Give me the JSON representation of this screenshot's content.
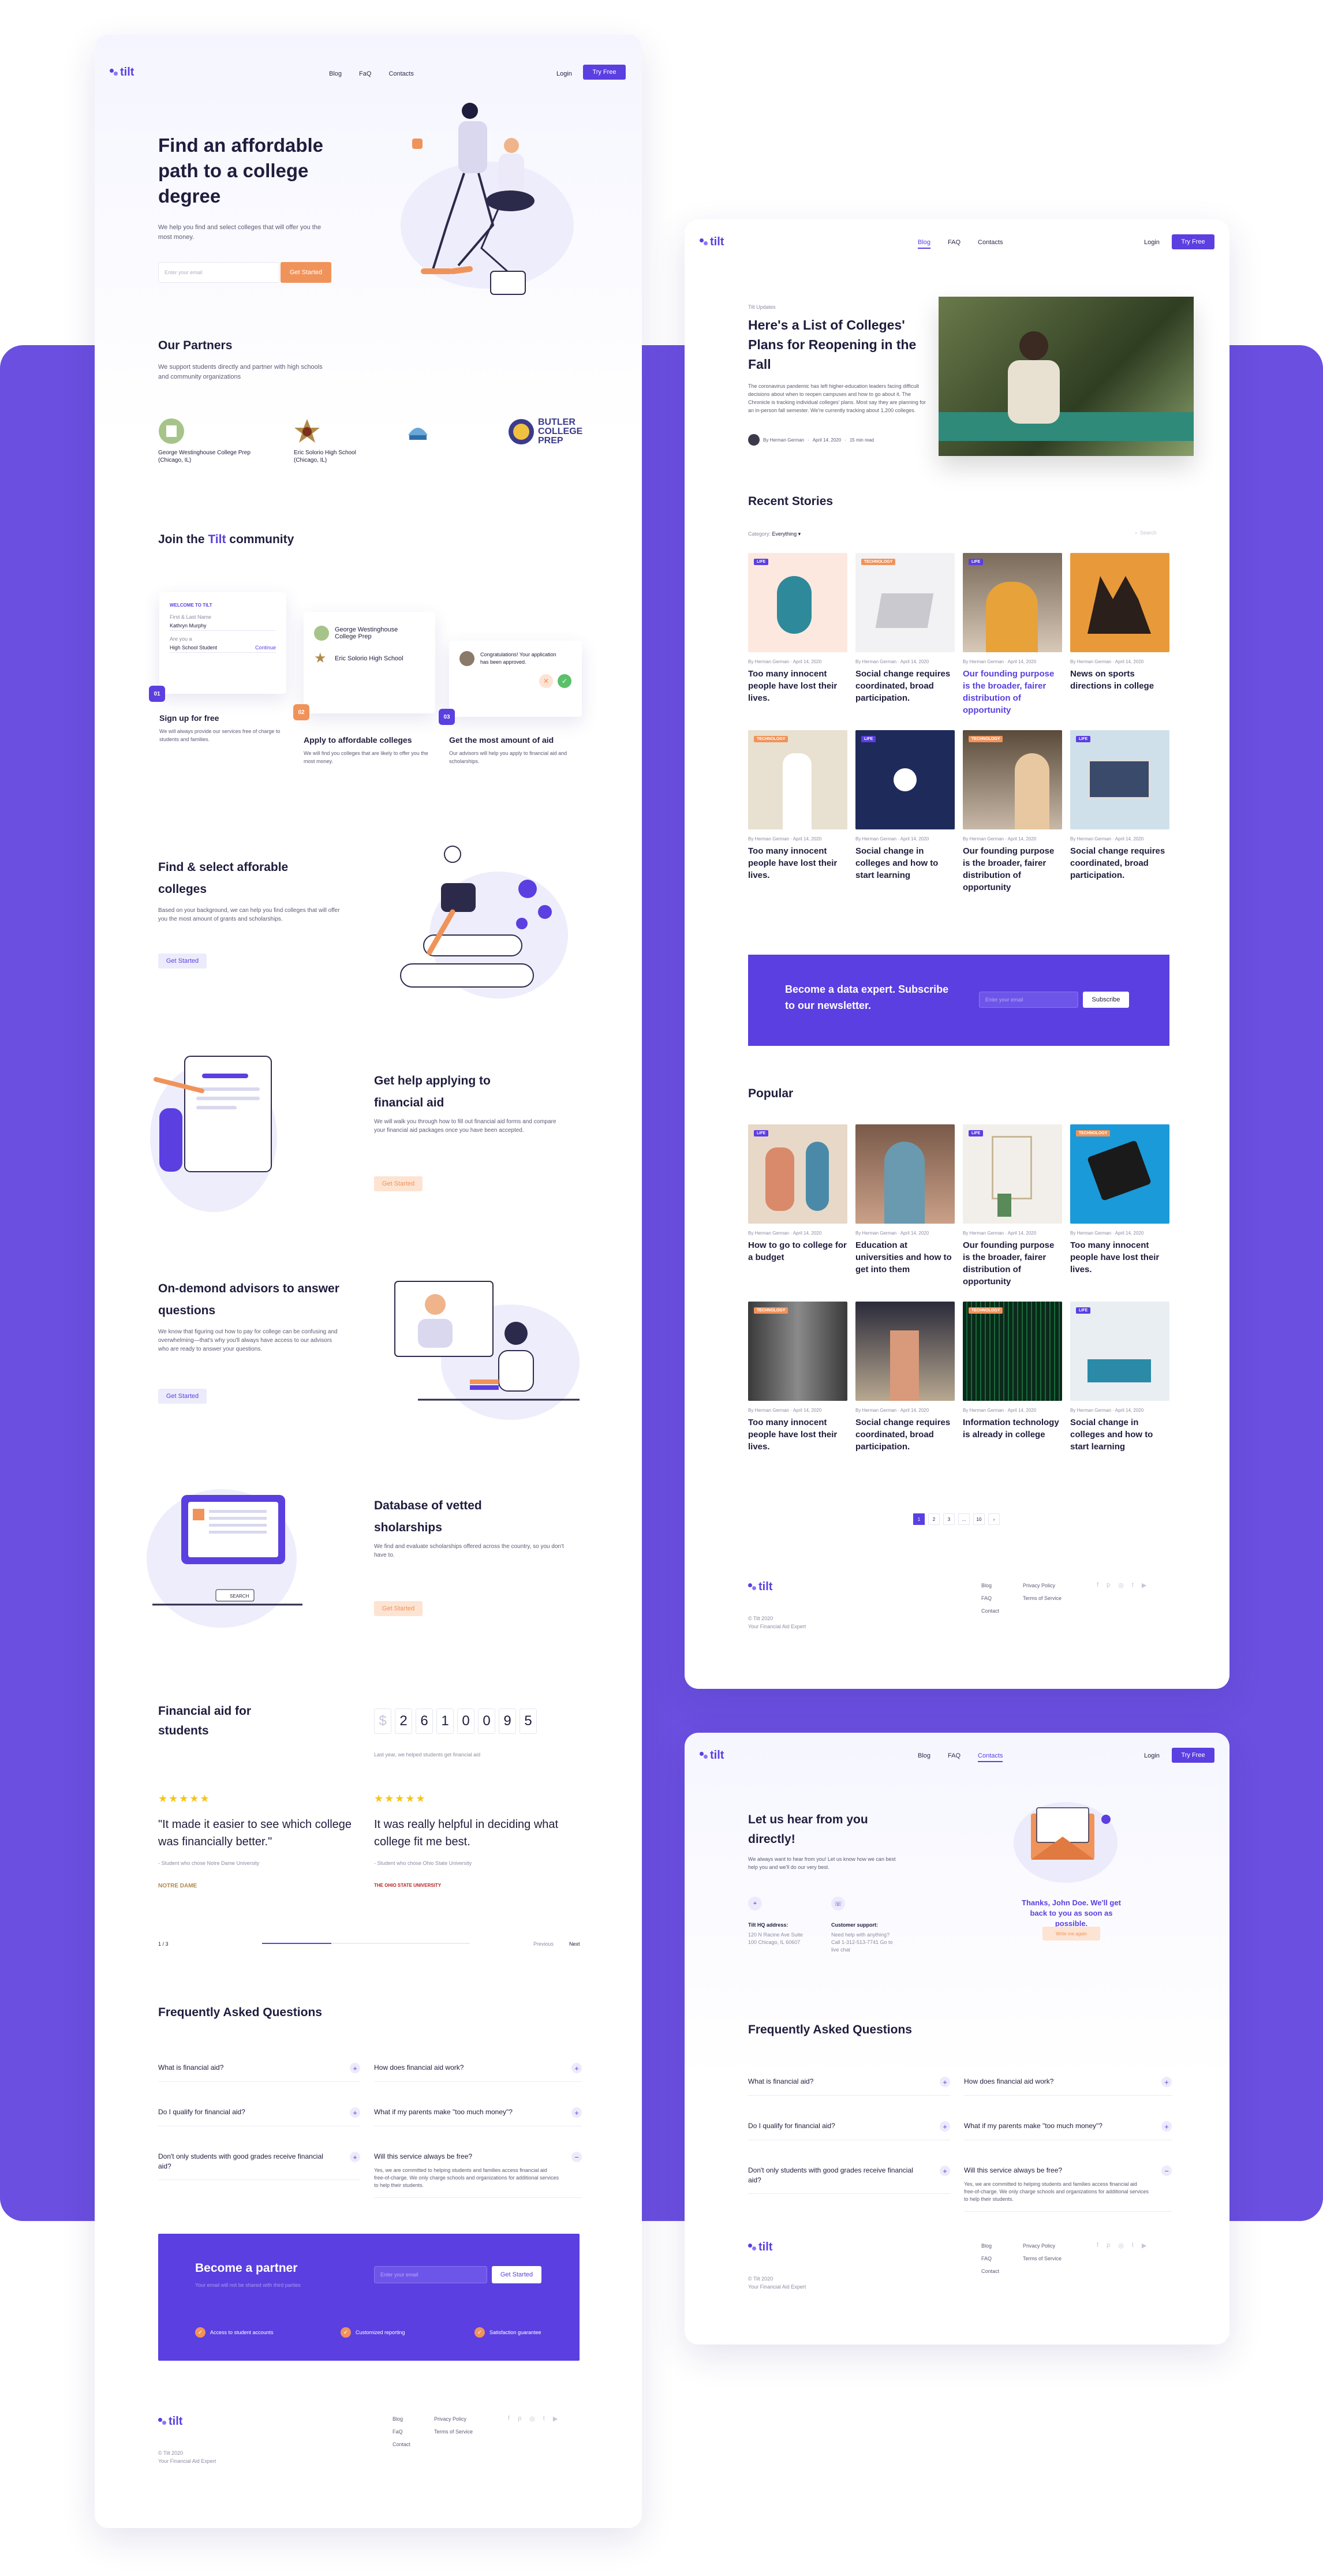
{
  "colors": {
    "brand": "#5b3fe0",
    "accent_orange": "#f0935a",
    "band": "#6b4fe0",
    "star": "#f5c518"
  },
  "brand": {
    "name": "tilt"
  },
  "home": {
    "nav": {
      "blog": "Blog",
      "faq": "FaQ",
      "contacts": "Contacts",
      "login": "Login",
      "try": "Try Free"
    },
    "hero": {
      "title": "Find an affordable path to a college degree",
      "subtitle": "We help you find and select colleges that will offer you the most money.",
      "email_placeholder": "Enter your email",
      "cta": "Get Started"
    },
    "partners": {
      "title": "Our Partners",
      "subtitle": "We support students directly and partner with high schools and community organizations",
      "items": [
        {
          "name": "George Westinghouse College Prep (Chicago, IL)"
        },
        {
          "name": "Eric Solorio High School (Chicago, IL)"
        },
        {
          "name": ""
        },
        {
          "name": "BUTLER COLLEGE PREP"
        }
      ]
    },
    "community": {
      "title_prefix": "Join the ",
      "title_brand": "Tilt",
      "title_suffix": " community",
      "card1": {
        "header": "WELCOME TO TILT",
        "l1": "First & Last Name",
        "l2": "Kathryn Murphy",
        "l3": "Are you a",
        "l4": "High School Student",
        "continue": "Continue"
      },
      "card2": {
        "s1": "George Westinghouse College Prep",
        "s2": "Eric Solorio High School"
      },
      "card3": {
        "msg": "Congratulations! Your application has been approved."
      },
      "steps": [
        {
          "num": "01",
          "title": "Sign up for free",
          "text": "We will always provide our services free of charge to students and families."
        },
        {
          "num": "02",
          "title": "Apply to affordable colleges",
          "text": "We will find you colleges that are likely to offer you the most money."
        },
        {
          "num": "03",
          "title": "Get the most amount of aid",
          "text": "Our advisors will help you apply to financial aid and scholarships."
        }
      ]
    },
    "feature1": {
      "title": "Find & select afforable colleges",
      "text": "Based on your background, we can help you find colleges that will offer you the most amount of grants and scholarships.",
      "cta": "Get Started"
    },
    "feature2": {
      "title": "Get help applying to financial aid",
      "text": "We will walk you through how to fill out financial aid forms and compare your financial aid packages once you have been accepted.",
      "cta": "Get Started"
    },
    "feature3": {
      "title": "On-demond advisors to answer questions",
      "text": "We know that figuring out how to pay for college can be confusing and overwhelming—that's why you'll always have access to our advisors who are ready to answer your questions.",
      "cta": "Get Started"
    },
    "feature4": {
      "title": "Database of vetted sholarships",
      "text": "We find and evaluate scholarships offered across the country, so you don't have to.",
      "cta": "Get Started",
      "search": "SEARCH"
    },
    "stats": {
      "title": "Financial aid for students",
      "digits": [
        "$",
        "2",
        "6",
        "1",
        "0",
        "0",
        "9",
        "5"
      ],
      "caption": "Last year, we helped students get financial aid"
    },
    "testimonials": [
      {
        "stars": "★★★★★",
        "quote": "\"It made it easier to see which college was financially better.\"",
        "author": "- Student who chose Notre Dame University",
        "logo": "NOTRE DAME"
      },
      {
        "stars": "★★★★★",
        "quote": "It was really helpful in deciding what college fit me best.",
        "author": "- Student who chose Ohio State University",
        "logo": "THE OHIO STATE UNIVERSITY"
      }
    ],
    "slider": {
      "counter": "1 / 3",
      "prev": "Previous",
      "next": "Next"
    },
    "faq": {
      "title": "Frequently Asked Questions",
      "left": [
        "What is financial aid?",
        "Do I qualify for financial aid?",
        "Don't only students with good grades receive financial aid?"
      ],
      "right": [
        "How does financial aid work?",
        "What if my parents make \"too much money\"?",
        "Will this service always be free?"
      ],
      "answer": "Yes, we are committed to helping students and families access financial aid free-of-charge. We only charge schools and organizations for additional services to help their students."
    },
    "partner_cta": {
      "title": "Become a partner",
      "subtitle": "Your email will not be shared with third parties",
      "placeholder": "Enter your email",
      "cta": "Get Started",
      "benefits": [
        "Access to student accounts",
        "Customized reporting",
        "Satisfaction guarantee"
      ]
    },
    "footer": {
      "copy": "© Tilt 2020",
      "tag": "Your Financial Aid Expert",
      "links1": [
        "Blog",
        "FaQ",
        "Contact"
      ],
      "links2": [
        "Privacy Policy",
        "Terms of Service"
      ]
    }
  },
  "blog": {
    "nav": {
      "blog": "Blog",
      "faq": "FAQ",
      "contacts": "Contacts",
      "login": "Login",
      "try": "Try Free"
    },
    "featured": {
      "tag": "Tilt Updates",
      "title": "Here's a List of Colleges' Plans for Reopening in the Fall",
      "text": "The coronavirus pandemic has left higher-education leaders facing difficult decisions about when to reopen campuses and how to go about it. The Chronicle is tracking individual colleges' plans. Most say they are planning for an in-person fall semester. We're currently tracking about 1,200 colleges.",
      "author": "By Herman German",
      "date": "April 14, 2020",
      "read": "15 min read"
    },
    "recent_title": "Recent Stories",
    "category_label": "Category:",
    "category_value": "Everything",
    "search_placeholder": "Search",
    "recent": [
      {
        "badge": "LIFE",
        "meta": "By Herman German · April 14, 2020",
        "title": "Too many innocent people have lost their lives."
      },
      {
        "badge": "TECHNOLOGY",
        "meta": "By Herman German · April 14, 2020",
        "title": "Social change requires coordinated, broad participation."
      },
      {
        "badge": "LIFE",
        "meta": "By Herman German · April 14, 2020",
        "title": "Our founding purpose is the broader, fairer distribution of opportunity"
      },
      {
        "badge": "",
        "meta": "By Herman German · April 14, 2020",
        "title": "News on sports directions in college"
      },
      {
        "badge": "TECHNOLOGY",
        "meta": "By Herman German · April 14, 2020",
        "title": "Too many innocent people have lost their lives."
      },
      {
        "badge": "LIFE",
        "meta": "By Herman German · April 14, 2020",
        "title": "Social change in colleges and how to start learning"
      },
      {
        "badge": "TECHNOLOGY",
        "meta": "By Herman German · April 14, 2020",
        "title": "Our founding purpose is the broader, fairer distribution of opportunity"
      },
      {
        "badge": "LIFE",
        "meta": "By Herman German · April 14, 2020",
        "title": "Social change requires coordinated, broad participation."
      }
    ],
    "newsletter": {
      "title": "Become a data expert. Subscribe to our newsletter.",
      "placeholder": "Enter your email",
      "cta": "Subscribe"
    },
    "popular_title": "Popular",
    "popular": [
      {
        "badge": "LIFE",
        "meta": "By Herman German · April 14, 2020",
        "title": "How to go to college for a budget"
      },
      {
        "badge": "",
        "meta": "By Herman German · April 14, 2020",
        "title": "Education at universities and how to get into them"
      },
      {
        "badge": "LIFE",
        "meta": "By Herman German · April 14, 2020",
        "title": "Our founding purpose is the broader, fairer distribution of opportunity"
      },
      {
        "badge": "TECHNOLOGY",
        "meta": "By Herman German · April 14, 2020",
        "title": "Too many innocent people have lost their lives."
      },
      {
        "badge": "TECHNOLOGY",
        "meta": "By Herman German · April 14, 2020",
        "title": "Too many innocent people have lost their lives."
      },
      {
        "badge": "",
        "meta": "By Herman German · April 14, 2020",
        "title": "Social change requires coordinated, broad participation."
      },
      {
        "badge": "TECHNOLOGY",
        "meta": "By Herman German · April 14, 2020",
        "title": "Information technology is already in college"
      },
      {
        "badge": "LIFE",
        "meta": "By Herman German · April 14, 2020",
        "title": "Social change in colleges and how to start learning"
      }
    ],
    "pagination": [
      "1",
      "2",
      "3",
      "...",
      "10",
      "›"
    ],
    "footer": {
      "copy": "© Tilt 2020",
      "tag": "Your Financial Aid Expert",
      "links1": [
        "Blog",
        "FAQ",
        "Contact"
      ],
      "links2": [
        "Privacy Policy",
        "Terms of Service"
      ]
    }
  },
  "contact": {
    "nav": {
      "blog": "Blog",
      "faq": "FAQ",
      "contacts": "Contacts",
      "login": "Login",
      "try": "Try Free"
    },
    "title": "Let us hear from you directly!",
    "text": "We always want to hear from you! Let us know how we can best help you and we'll do our very best.",
    "hq_title": "Tilt HQ address:",
    "hq_text": "120 N Racine Ave Suite 100 Chicago, IL 60607",
    "support_title": "Customer support:",
    "support_text": "Need help with anything? Call 1-312-513-7741 Go to live chat",
    "thanks": "Thanks, John Doe. We'll get back to you as soon as possible.",
    "back": "Write me again",
    "faq": {
      "title": "Frequently Asked Questions",
      "left": [
        "What is financial aid?",
        "Do I qualify for financial aid?",
        "Don't only students with good grades receive financial aid?"
      ],
      "right": [
        "How does financial aid work?",
        "What if my parents make \"too much money\"?",
        "Will this service always be free?"
      ],
      "answer": "Yes, we are committed to helping students and families access financial aid free-of-charge. We only charge schools and organizations for additional services to help their students."
    },
    "footer": {
      "copy": "© Tilt 2020",
      "tag": "Your Financial Aid Expert",
      "links1": [
        "Blog",
        "FAQ",
        "Contact"
      ],
      "links2": [
        "Privacy Policy",
        "Terms of Service"
      ]
    }
  }
}
